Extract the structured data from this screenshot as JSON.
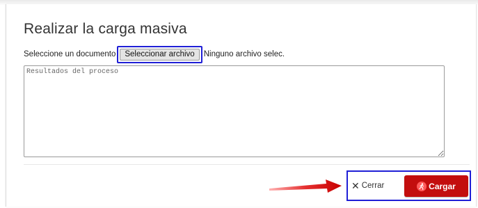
{
  "dialog": {
    "title": "Realizar la carga masiva"
  },
  "file_input": {
    "label": "Seleccione un documento",
    "button_label": "Seleccionar archivo",
    "status_text": "Ninguno archivo selec."
  },
  "results": {
    "placeholder": "Resultados del proceso"
  },
  "footer": {
    "close_label": "Cerrar",
    "load_label": "Cargar"
  },
  "colors": {
    "primary": "#c30e0e",
    "highlight_box": "#1f1fd6",
    "arrow": "#e01010"
  },
  "icons": {
    "close": "close-icon",
    "load": "running-person-icon",
    "annotation": "red-arrow-icon"
  }
}
